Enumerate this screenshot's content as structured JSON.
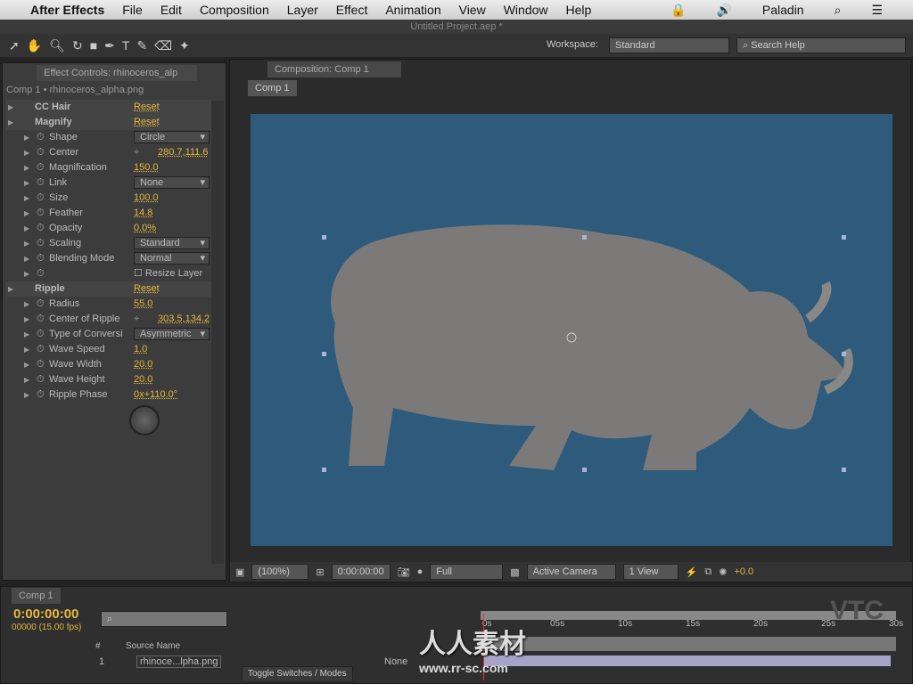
{
  "menubar": {
    "app": "After Effects",
    "items": [
      "File",
      "Edit",
      "Composition",
      "Layer",
      "Effect",
      "Animation",
      "View",
      "Window",
      "Help"
    ],
    "user": "Paladin"
  },
  "titlebar": {
    "title": "Untitled Project.aep *"
  },
  "toolbar": {
    "workspace_label": "Workspace:",
    "workspace_value": "Standard",
    "search_placeholder": "Search Help"
  },
  "effect_panel": {
    "tab": "Effect Controls: rhinoceros_alp",
    "breadcrumb": "Comp 1 • rhinoceros_alpha.png",
    "rows": [
      {
        "name": "CC Hair",
        "value": "Reset",
        "kind": "effect"
      },
      {
        "name": "Magnify",
        "value": "Reset",
        "kind": "effect"
      },
      {
        "name": "Shape",
        "value": "Circle",
        "kind": "dropdown"
      },
      {
        "name": "Center",
        "value": "280.7,111.6",
        "kind": "point"
      },
      {
        "name": "Magnification",
        "value": "150.0",
        "kind": "value"
      },
      {
        "name": "Link",
        "value": "None",
        "kind": "dropdown"
      },
      {
        "name": "Size",
        "value": "100.0",
        "kind": "value"
      },
      {
        "name": "Feather",
        "value": "14.8",
        "kind": "value"
      },
      {
        "name": "Opacity",
        "value": "0.0%",
        "kind": "value"
      },
      {
        "name": "Scaling",
        "value": "Standard",
        "kind": "dropdown"
      },
      {
        "name": "Blending Mode",
        "value": "Normal",
        "kind": "dropdown"
      },
      {
        "name": "",
        "value": "Resize Layer",
        "kind": "checkbox"
      },
      {
        "name": "Ripple",
        "value": "Reset",
        "kind": "effect"
      },
      {
        "name": "Radius",
        "value": "55.0",
        "kind": "value"
      },
      {
        "name": "Center of Ripple",
        "value": "303.5,134.2",
        "kind": "point"
      },
      {
        "name": "Type of Conversi",
        "value": "Asymmetric",
        "kind": "dropdown"
      },
      {
        "name": "Wave Speed",
        "value": "1.0",
        "kind": "value"
      },
      {
        "name": "Wave Width",
        "value": "20.0",
        "kind": "value"
      },
      {
        "name": "Wave Height",
        "value": "20.0",
        "kind": "value"
      },
      {
        "name": "Ripple Phase",
        "value": "0x+110.0°",
        "kind": "value"
      }
    ]
  },
  "comp_panel": {
    "tab": "Composition: Comp 1",
    "comp_tab": "Comp 1",
    "bg_color": "#2e5a7c",
    "footer": {
      "zoom": "(100%)",
      "time": "0:00:00:00",
      "resolution": "Full",
      "camera": "Active Camera",
      "views": "1 View",
      "exposure": "+0.0"
    }
  },
  "timeline": {
    "tab": "Comp 1",
    "time": "0:00:00:00",
    "frames": "00000 (15.00 fps)",
    "source_header": "Source Name",
    "num_header": "#",
    "ruler": [
      "0s",
      "05s",
      "10s",
      "15s",
      "20s",
      "25s",
      "30s"
    ],
    "layer": {
      "index": "1",
      "name": "rhinoce...lpha.png",
      "mode": "None"
    },
    "toggle": "Toggle Switches / Modes"
  },
  "watermark": {
    "text": "人人素材",
    "url": "www.rr-sc.com",
    "corner": "VTC"
  }
}
